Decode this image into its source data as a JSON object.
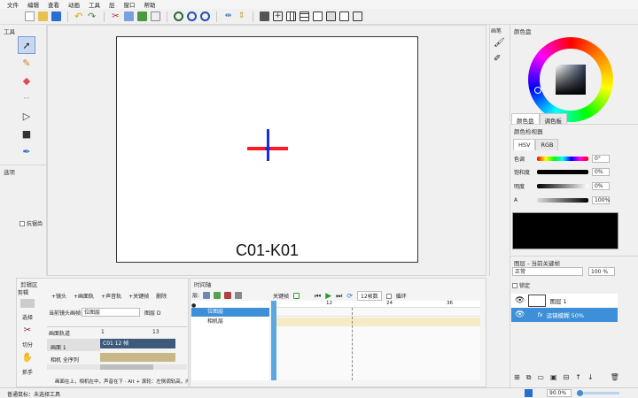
{
  "menu": [
    "文件",
    "编辑",
    "查看",
    "动画",
    "工具",
    "层",
    "窗口",
    "帮助"
  ],
  "toolbar_icons": [
    "new-file-icon",
    "open-folder-icon",
    "save-icon",
    "undo-icon",
    "redo-icon",
    "cut-icon",
    "copy-icon",
    "paste-icon",
    "duplicate-icon",
    "zoom-in-icon",
    "zoom-out-icon",
    "zoom-fit-icon",
    "flip-h-icon",
    "flip-v-icon",
    "frame-icon",
    "add-frame-icon",
    "grid-icon",
    "grid2-icon",
    "camera-icon",
    "onion-icon",
    "key-icon",
    "export-icon"
  ],
  "tools_panel": {
    "title": "工具"
  },
  "options_panel": {
    "title": "选项",
    "checkbox_label": "抗锯齿"
  },
  "canvas": {
    "scene_label": "C01-K01"
  },
  "brush_panel": {
    "title": "画笔"
  },
  "color_wheel": {
    "title": "颜色盘",
    "tabs": [
      "颜色盘",
      "调色板"
    ]
  },
  "color_inspector": {
    "title": "颜色检视器",
    "tabs": [
      "HSV",
      "RGB"
    ],
    "rows": [
      {
        "label": "色调",
        "value": "0°"
      },
      {
        "label": "饱和度",
        "value": "0%"
      },
      {
        "label": "明度",
        "value": "0%"
      },
      {
        "label": "A",
        "value": "100%"
      }
    ],
    "current_color": "#000000"
  },
  "layers_panel": {
    "title": "图层 - 当前关键帧",
    "blend_mode": "正常",
    "opacity": "100 %",
    "lock_label": "锁定",
    "layers": [
      {
        "name": "图层 1"
      },
      {
        "name": "运镜模糊 50%",
        "prefix": "fx"
      }
    ]
  },
  "cut_panel": {
    "title": "剪辑区",
    "sub_title": "剪辑",
    "actions": [
      "+镜头",
      "+画面轨",
      "+声音轨",
      "+关键帧",
      "删除"
    ],
    "current_label": "当前镜头画帧:",
    "current_value": "位图层",
    "layer_label": "图层 D",
    "sidebar": [
      "选择",
      "切分",
      "抓手"
    ],
    "tracks": [
      {
        "name": "画面轨道",
        "col1": "1",
        "col2": "13"
      },
      {
        "name": "画面 1",
        "clip": "C01   12 帧"
      },
      {
        "name": "相机    全序列"
      }
    ],
    "hint": "画面在上，相机在中，声音在下 · Alt + 滚轮：左侧调轨高，内容"
  },
  "timeline_panel": {
    "title": "时间轴",
    "layers_label": "层:",
    "key_label": "关键帧",
    "fps": "12帧数",
    "loop_label": "循环",
    "ruler": [
      "12",
      "24",
      "36"
    ],
    "layers": [
      {
        "name": "位图层",
        "active": true
      },
      {
        "name": "相机层",
        "active": false
      }
    ]
  },
  "status": {
    "text": "普通鼠标：未选择工具",
    "zoom": "90.0%"
  }
}
